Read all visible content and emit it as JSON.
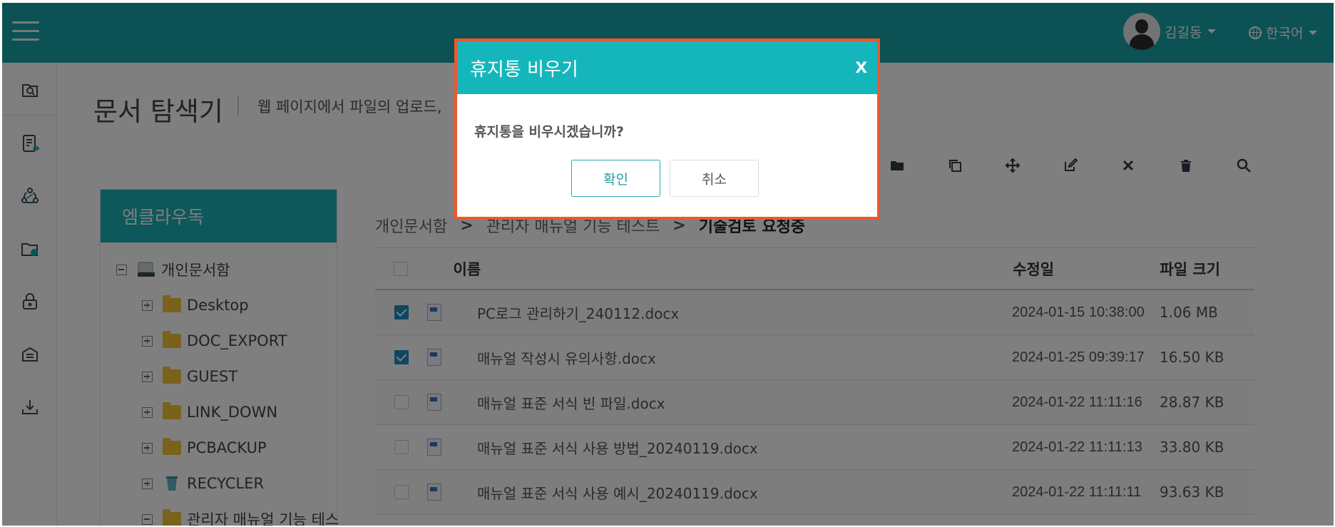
{
  "header": {
    "user_name": "김길동",
    "language": "한국어"
  },
  "rail": {
    "items": [
      "document-explorer-icon",
      "document-send-icon",
      "share-icon",
      "folder-settings-icon",
      "lock-icon",
      "inbox-icon",
      "download-icon"
    ]
  },
  "page": {
    "title": "문서 탐색기",
    "description": "웹 페이지에서 파일의 업로드,"
  },
  "toolbar": {
    "tools": [
      "folder-icon",
      "copy-icon",
      "move-icon",
      "edit-icon",
      "delete-x-icon",
      "trash-icon",
      "search-icon"
    ]
  },
  "tree": {
    "header": "엠클라우독",
    "root": "개인문서함",
    "items": [
      "Desktop",
      "DOC_EXPORT",
      "GUEST",
      "LINK_DOWN",
      "PCBACKUP",
      "RECYCLER",
      "관리자 매뉴얼 기능 테스"
    ]
  },
  "breadcrumb": {
    "items": [
      "개인문서함",
      "관리자 매뉴얼 기능 테스트"
    ],
    "current": "기술검토 요청중"
  },
  "table": {
    "headers": {
      "name": "이름",
      "date": "수정일",
      "size": "파일 크기"
    },
    "rows": [
      {
        "checked": true,
        "name": "PC로그 관리하기_240112.docx",
        "date": "2024-01-15 10:38:00",
        "size": "1.06 MB"
      },
      {
        "checked": true,
        "name": "매뉴얼 작성시 유의사항.docx",
        "date": "2024-01-25 09:39:17",
        "size": "16.50 KB"
      },
      {
        "checked": false,
        "name": "매뉴얼 표준 서식 빈 파일.docx",
        "date": "2024-01-22 11:11:16",
        "size": "28.87 KB"
      },
      {
        "checked": false,
        "name": "매뉴얼 표준 서식 사용 방법_20240119.docx",
        "date": "2024-01-22 11:11:13",
        "size": "33.80 KB"
      },
      {
        "checked": false,
        "name": "매뉴얼 표준 서식 사용 예시_20240119.docx",
        "date": "2024-01-22 11:11:11",
        "size": "93.63 KB"
      }
    ]
  },
  "modal": {
    "title": "휴지통 비우기",
    "close": "x",
    "message": "휴지통을 비우시겠습니까?",
    "confirm": "확인",
    "cancel": "취소"
  },
  "colors": {
    "topbar": "#18a3a9",
    "modal_header": "#15b6bb",
    "modal_border": "#f0562c",
    "checkbox": "#1d8fc6"
  }
}
